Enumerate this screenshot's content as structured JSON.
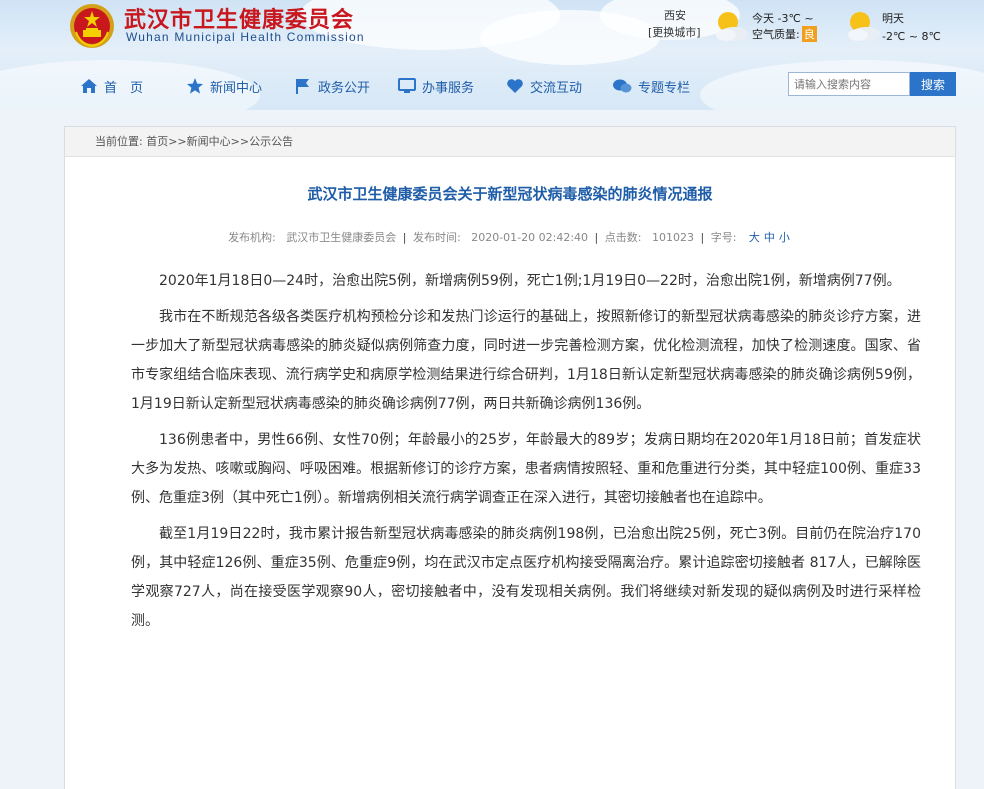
{
  "header": {
    "title_cn": "武汉市卫生健康委员会",
    "title_en": "Wuhan Municipal Health Commission"
  },
  "weather": {
    "city": "西安",
    "change_city": "[更换城市]",
    "today_label": "今天",
    "today_temp": "-3℃ ~",
    "aq_label": "空气质量:",
    "aq_value": "良",
    "tomorrow_label": "明天",
    "tomorrow_temp": "-2℃ ~ 8℃"
  },
  "nav": {
    "items": [
      {
        "label": "首　页",
        "icon": "home-icon"
      },
      {
        "label": "新闻中心",
        "icon": "star-icon"
      },
      {
        "label": "政务公开",
        "icon": "flag-icon"
      },
      {
        "label": "办事服务",
        "icon": "monitor-icon"
      },
      {
        "label": "交流互动",
        "icon": "heart-icon"
      },
      {
        "label": "专题专栏",
        "icon": "chat-icon"
      }
    ],
    "search_placeholder": "请输入搜索内容",
    "search_button": "搜索"
  },
  "breadcrumb": {
    "prefix": "当前位置:",
    "items": [
      "首页",
      "新闻中心",
      "公示公告"
    ],
    "separator": ">>"
  },
  "article": {
    "title": "武汉市卫生健康委员会关于新型冠状病毒感染的肺炎情况通报",
    "meta": {
      "publisher_label": "发布机构:",
      "publisher": "武汉市卫生健康委员会",
      "time_label": "发布时间:",
      "time": "2020-01-20 02:42:40",
      "clicks_label": "点击数:",
      "clicks": "101023",
      "fontsize_label": "字号:",
      "size_large": "大",
      "size_medium": "中",
      "size_small": "小"
    },
    "paragraphs": [
      "2020年1月18日0—24时，治愈出院5例，新增病例59例，死亡1例;1月19日0—22时，治愈出院1例，新增病例77例。",
      "我市在不断规范各级各类医疗机构预检分诊和发热门诊运行的基础上，按照新修订的新型冠状病毒感染的肺炎诊疗方案，进一步加大了新型冠状病毒感染的肺炎疑似病例筛查力度，同时进一步完善检测方案，优化检测流程，加快了检测速度。国家、省市专家组结合临床表现、流行病学史和病原学检测结果进行综合研判，1月18日新认定新型冠状病毒感染的肺炎确诊病例59例，1月19日新认定新型冠状病毒感染的肺炎确诊病例77例，两日共新确诊病例136例。",
      "136例患者中，男性66例、女性70例；年龄最小的25岁，年龄最大的89岁；发病日期均在2020年1月18日前；首发症状大多为发热、咳嗽或胸闷、呼吸困难。根据新修订的诊疗方案，患者病情按照轻、重和危重进行分类，其中轻症100例、重症33例、危重症3例（其中死亡1例）。新增病例相关流行病学调查正在深入进行，其密切接触者也在追踪中。",
      "截至1月19日22时，我市累计报告新型冠状病毒感染的肺炎病例198例，已治愈出院25例，死亡3例。目前仍在院治疗170例，其中轻症126例、重症35例、危重症9例，均在武汉市定点医疗机构接受隔离治疗。累计追踪密切接触者 817人，已解除医学观察727人，尚在接受医学观察90人，密切接触者中，没有发现相关病例。我们将继续对新发现的疑似病例及时进行采样检测。"
    ]
  }
}
